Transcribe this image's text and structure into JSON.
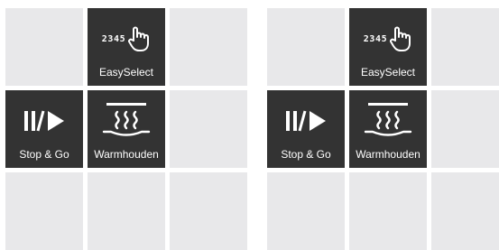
{
  "colors": {
    "tile_active_bg": "#333333",
    "tile_inactive_bg": "#e8e8ea",
    "tile_text": "#ffffff"
  },
  "panels": [
    {
      "easyselect": {
        "number": "2345",
        "label": "EasySelect",
        "icon": "hand-pointer-icon"
      },
      "stopgo": {
        "label": "Stop & Go",
        "icon": "pause-play-icon"
      },
      "warmhouden": {
        "label": "Warmhouden",
        "icon": "keep-warm-icon"
      }
    },
    {
      "easyselect": {
        "number": "2345",
        "label": "EasySelect",
        "icon": "hand-pointer-icon"
      },
      "stopgo": {
        "label": "Stop & Go",
        "icon": "pause-play-icon"
      },
      "warmhouden": {
        "label": "Warmhouden",
        "icon": "keep-warm-icon"
      }
    }
  ]
}
